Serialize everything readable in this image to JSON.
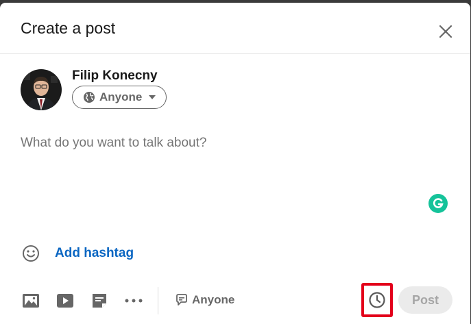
{
  "dialog": {
    "title": "Create a post",
    "close_icon": "close-icon"
  },
  "author": {
    "name": "Filip Konecny",
    "visibility": {
      "label": "Anyone",
      "icon": "globe-icon",
      "caret_icon": "caret-down-icon"
    }
  },
  "editor": {
    "placeholder": "What do you want to talk about?",
    "assistant_icon": "grammarly-icon",
    "assistant_color": "#15c39a"
  },
  "hashtag": {
    "emoji_icon": "emoji-icon",
    "label": "Add hashtag",
    "color": "#0a66c2"
  },
  "toolbar": {
    "tools": [
      {
        "icon": "photo-icon"
      },
      {
        "icon": "video-icon"
      },
      {
        "icon": "document-icon"
      },
      {
        "icon": "more-icon"
      }
    ],
    "comment_control": {
      "icon": "comment-icon",
      "label": "Anyone"
    },
    "schedule_icon": "clock-icon",
    "highlight_color": "#e3001b",
    "post_label": "Post"
  }
}
